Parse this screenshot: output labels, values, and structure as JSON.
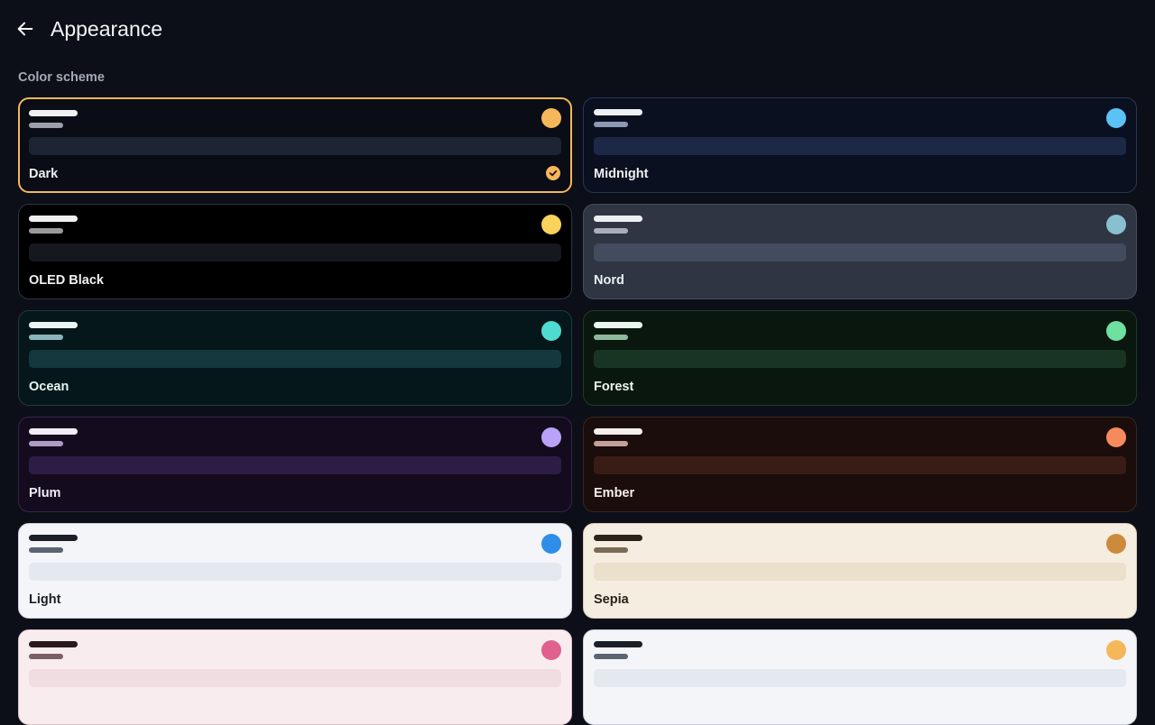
{
  "header": {
    "back_icon": "arrow-left-icon",
    "title": "Appearance"
  },
  "section": {
    "label": "Color scheme"
  },
  "selected_scheme": "Dark",
  "schemes": [
    {
      "name": "Dark",
      "selected": true,
      "bg": "#0a0d16",
      "border": "#f6b75a",
      "text": "#eef0f4",
      "line1": "#eef0f4",
      "line2": "#9aa1ad",
      "accent": "#f6b75a",
      "bar": "#1d2433"
    },
    {
      "name": "Midnight",
      "selected": false,
      "bg": "#0a1020",
      "border": "#2a3550",
      "text": "#eef0f4",
      "line1": "#eef0f4",
      "line2": "#8e99b3",
      "accent": "#5bc2f7",
      "bar": "#1b2947"
    },
    {
      "name": "OLED Black",
      "selected": false,
      "bg": "#000000",
      "border": "#2c3446",
      "text": "#f0f0f0",
      "line1": "#f0f0f0",
      "line2": "#9a9a9a",
      "accent": "#f9d35a",
      "bar": "#15181f"
    },
    {
      "name": "Nord",
      "selected": false,
      "bg": "#2f3542",
      "border": "#434c5e",
      "text": "#eceff4",
      "line1": "#eceff4",
      "line2": "#a7afbd",
      "accent": "#88c0d0",
      "bar": "#434c5e"
    },
    {
      "name": "Ocean",
      "selected": false,
      "bg": "#05171a",
      "border": "#1f3a40",
      "text": "#eaf4f5",
      "line1": "#eaf4f5",
      "line2": "#8bb5bb",
      "accent": "#4fdbd0",
      "bar": "#14383e"
    },
    {
      "name": "Forest",
      "selected": false,
      "bg": "#0a170f",
      "border": "#1f3a28",
      "text": "#eaf5ee",
      "line1": "#eaf5ee",
      "line2": "#8fb99c",
      "accent": "#6ee0a0",
      "bar": "#183523"
    },
    {
      "name": "Plum",
      "selected": false,
      "bg": "#140c1e",
      "border": "#33264a",
      "text": "#f1ecf8",
      "line1": "#f1ecf8",
      "line2": "#ad9bc6",
      "accent": "#b9a3f8",
      "bar": "#2c1d47"
    },
    {
      "name": "Ember",
      "selected": false,
      "bg": "#1a0d0b",
      "border": "#3a2520",
      "text": "#f8eeeb",
      "line1": "#f8eeeb",
      "line2": "#c4a198",
      "accent": "#f78a5c",
      "bar": "#3a1c16"
    },
    {
      "name": "Light",
      "selected": false,
      "bg": "#f3f5f9",
      "border": "#c9ced8",
      "text": "#1b1f27",
      "line1": "#1b1f27",
      "line2": "#5c6472",
      "accent": "#2f8ee8",
      "bar": "#e4e8ef"
    },
    {
      "name": "Sepia",
      "selected": false,
      "bg": "#f5ede0",
      "border": "#d9ccb5",
      "text": "#2b2218",
      "line1": "#2b2218",
      "line2": "#7a6b56",
      "accent": "#cc8a3c",
      "bar": "#ebe0cb"
    },
    {
      "name": "",
      "selected": false,
      "bg": "#f9ecef",
      "border": "#d9c3c9",
      "text": "#2a1a1f",
      "line1": "#2a1a1f",
      "line2": "#7a5e66",
      "accent": "#e0608e",
      "bar": "#f0dde2"
    },
    {
      "name": "",
      "selected": false,
      "bg": "#f3f5f9",
      "border": "#c9ced8",
      "text": "#1b1f27",
      "line1": "#1b1f27",
      "line2": "#5c6472",
      "accent": "#f6b75a",
      "bar": "#e4e8ef"
    }
  ]
}
